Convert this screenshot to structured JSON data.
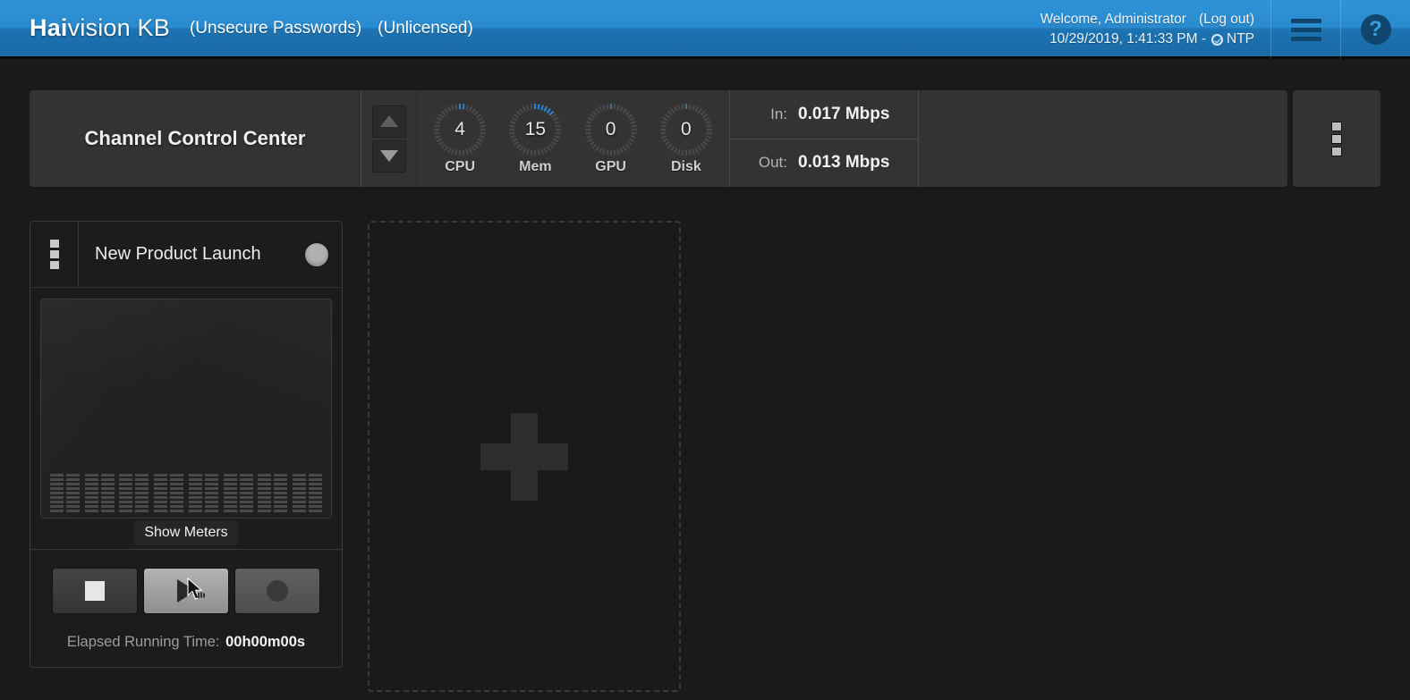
{
  "header": {
    "brand_bold": "Hai",
    "brand_rest": "vision KB",
    "tag_passwords": "(Unsecure Passwords)",
    "tag_license": "(Unlicensed)",
    "welcome": "Welcome, Administrator",
    "logout": "(Log out)",
    "datetime": "10/29/2019, 1:41:33 PM  -",
    "ntp_label": "NTP",
    "menu_icon": "hamburger-icon",
    "help_icon": "help-icon",
    "help_glyph": "?",
    "accent_blue": "#2a8bcf"
  },
  "toolbar": {
    "title": "Channel Control Center",
    "nav_up_icon": "chevron-up-icon",
    "nav_down_icon": "chevron-down-icon",
    "gauges": [
      {
        "label": "CPU",
        "value": "4",
        "percent": 4
      },
      {
        "label": "Mem",
        "value": "15",
        "percent": 15
      },
      {
        "label": "GPU",
        "value": "0",
        "percent": 0
      },
      {
        "label": "Disk",
        "value": "0",
        "percent": 0
      }
    ],
    "gauge_active_color": "#2f83cf",
    "gauge_idle_color": "#4a4a4a",
    "network": {
      "in_label": "In:",
      "in_value": "0.017 Mbps",
      "out_label": "Out:",
      "out_value": "0.013 Mbps"
    },
    "overflow_icon": "kebab-menu-icon"
  },
  "channels": [
    {
      "menu_icon": "kebab-menu-icon",
      "name": "New Product Launch",
      "status_icon": "status-indicator",
      "status_color": "#b0b0b0",
      "meters_tooltip": "Show Meters",
      "meter_groups": 8,
      "meter_columns_per_group": 2,
      "meter_segments": 9,
      "transport": [
        {
          "name": "stop-button",
          "icon": "stop-icon",
          "state": "normal"
        },
        {
          "name": "play-button",
          "icon": "play-icon",
          "state": "hover"
        },
        {
          "name": "record-button",
          "icon": "record-icon",
          "state": "normal"
        }
      ],
      "elapsed_label": "Elapsed Running Time:",
      "elapsed_value": "00h00m00s"
    }
  ],
  "add_channel": {
    "icon": "plus-icon",
    "label": ""
  }
}
